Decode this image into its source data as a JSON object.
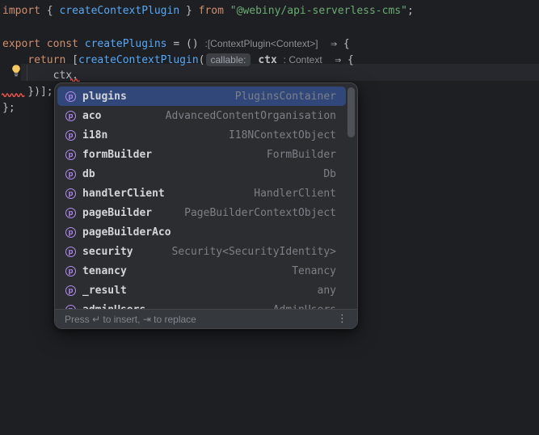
{
  "colors": {
    "editor_background": "#1e1f22",
    "caret_line": "#26282e",
    "keyword": "#cf8e6d",
    "function": "#57a8f5",
    "string": "#6aab73",
    "plain_text": "#bcbec4",
    "inlay_hint": "#8c9096",
    "error_red": "#f2564d",
    "popup_background": "#2b2d30",
    "selection_blue": "#31477a",
    "property_icon_purple": "#b48bf2",
    "lightbulb_yellow": "#f6c862"
  },
  "editor": {
    "lines": [
      {
        "tokens": [
          [
            "kw",
            "import"
          ],
          [
            "pl",
            " { "
          ],
          [
            "fn",
            "createContextPlugin"
          ],
          [
            "pl",
            " } "
          ],
          [
            "kw",
            "from"
          ],
          [
            "pl",
            " "
          ],
          [
            "str",
            "\"@webiny/api-serverless-cms\""
          ],
          [
            "pl",
            ";"
          ]
        ]
      },
      {
        "tokens": []
      },
      {
        "tokens": [
          [
            "kw",
            "export"
          ],
          [
            "pl",
            " "
          ],
          [
            "kw",
            "const"
          ],
          [
            "pl",
            " "
          ],
          [
            "fn",
            "createPlugins"
          ],
          [
            "pl",
            " = () "
          ],
          [
            "hint",
            ":[ContextPlugin<Context>]"
          ],
          [
            "pl",
            "  ⇒ {"
          ]
        ]
      },
      {
        "tokens": [
          [
            "pl",
            "    "
          ],
          [
            "kw",
            "return"
          ],
          [
            "pl",
            " ["
          ],
          [
            "fn",
            "createContextPlugin"
          ],
          [
            "pl",
            "("
          ],
          [
            "chip",
            "callable:"
          ],
          [
            "pl",
            " "
          ],
          [
            "param",
            "ctx"
          ],
          [
            "pl",
            " "
          ],
          [
            "hint",
            ": Context"
          ],
          [
            "pl",
            "  ⇒ {"
          ]
        ]
      },
      {
        "tokens": [
          [
            "pl",
            "        ctx."
          ]
        ]
      },
      {
        "tokens": [
          [
            "pl",
            "    })];"
          ]
        ]
      },
      {
        "tokens": [
          [
            "pl",
            "};"
          ]
        ]
      }
    ]
  },
  "popup": {
    "selected_index": 0,
    "icon_glyph": "p",
    "items": [
      {
        "name": "plugins",
        "type": "PluginsContainer"
      },
      {
        "name": "aco",
        "type": "AdvancedContentOrganisation"
      },
      {
        "name": "i18n",
        "type": "I18NContextObject"
      },
      {
        "name": "formBuilder",
        "type": "FormBuilder"
      },
      {
        "name": "db",
        "type": "Db"
      },
      {
        "name": "handlerClient",
        "type": "HandlerClient"
      },
      {
        "name": "pageBuilder",
        "type": "PageBuilderContextObject"
      },
      {
        "name": "pageBuilderAco",
        "type": ""
      },
      {
        "name": "security",
        "type": "Security<SecurityIdentity>"
      },
      {
        "name": "tenancy",
        "type": "Tenancy"
      },
      {
        "name": "_result",
        "type": "any"
      },
      {
        "name": "adminUsers",
        "type": "AdminUsers"
      }
    ],
    "footer": {
      "hint": "Press ↵ to insert, ⇥ to replace",
      "more_icon": "⋮"
    }
  }
}
